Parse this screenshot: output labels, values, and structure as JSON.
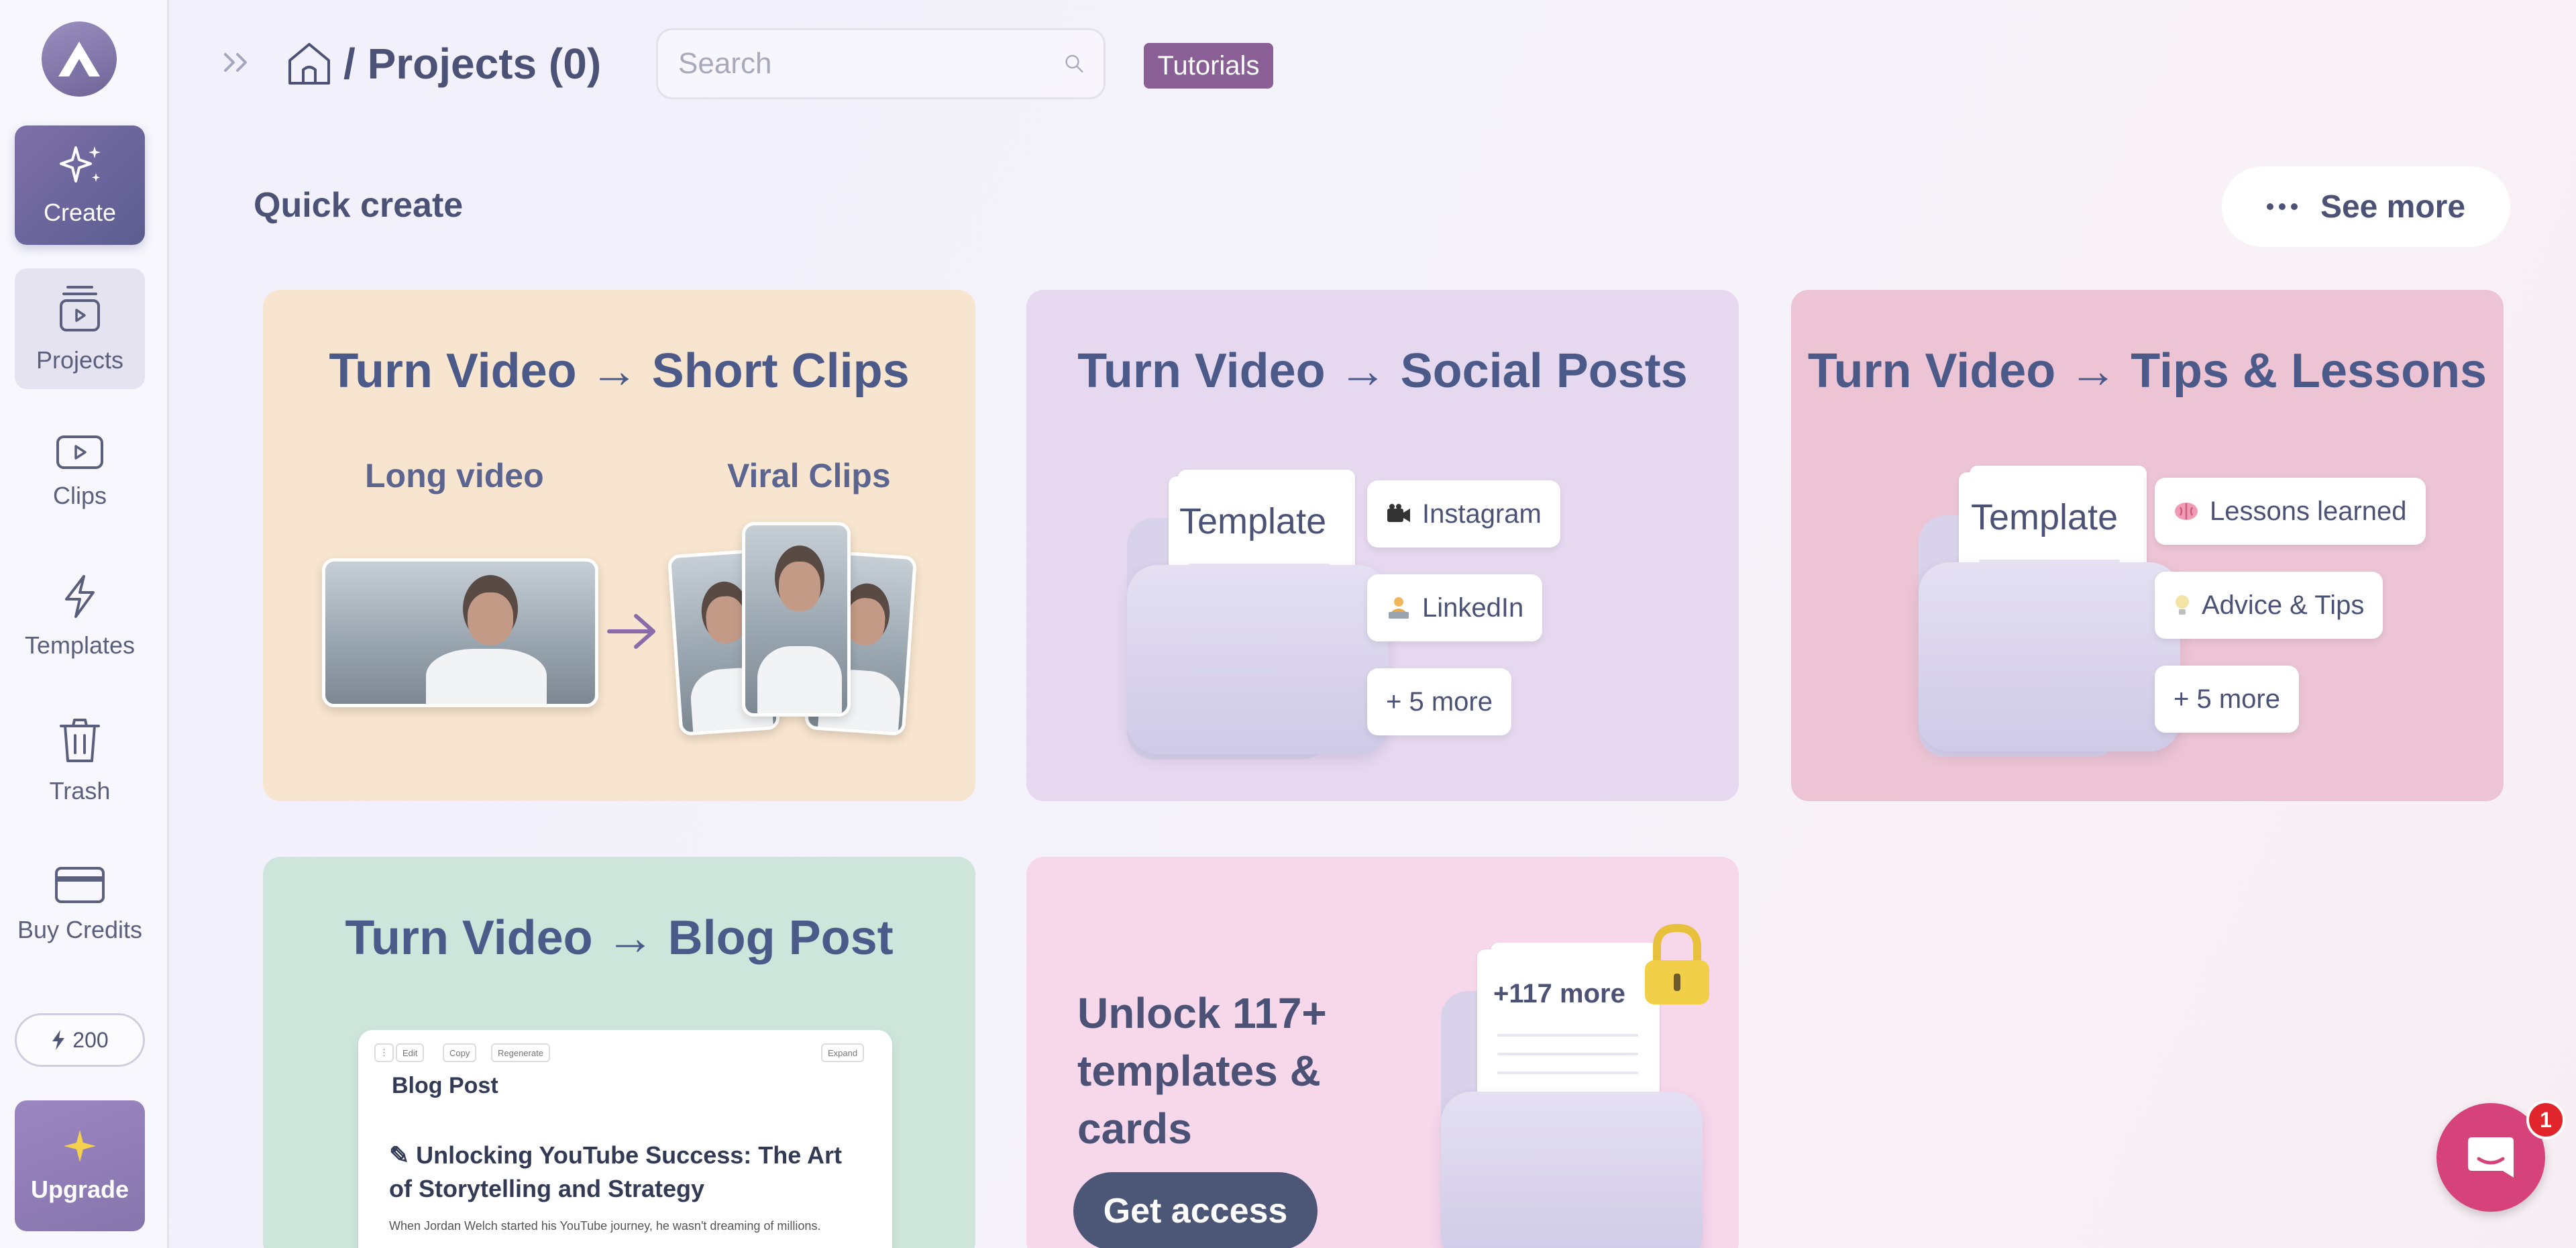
{
  "sidebar": {
    "create_label": "Create",
    "projects_label": "Projects",
    "clips_label": "Clips",
    "templates_label": "Templates",
    "trash_label": "Trash",
    "credits_label": "Buy Credits",
    "credits_count": "200",
    "upgrade_label": "Upgrade"
  },
  "header": {
    "breadcrumb_sep": "/",
    "title": "Projects (0)",
    "search_placeholder": "Search",
    "tutorials_label": "Tutorials"
  },
  "quick_create": {
    "title": "Quick create",
    "see_more_label": "See more",
    "cards": {
      "short_clips": {
        "title": "Turn Video → Short Clips",
        "left_label": "Long video",
        "right_label": "Viral Clips"
      },
      "social_posts": {
        "title": "Turn Video → Social Posts",
        "paper_title": "Template",
        "chips": [
          "Instagram",
          "LinkedIn",
          "+ 5 more"
        ]
      },
      "tips_lessons": {
        "title": "Turn Video → Tips & Lessons",
        "paper_title": "Template",
        "chips": [
          "Lessons learned",
          "Advice & Tips",
          "+ 5 more"
        ]
      },
      "blog_post": {
        "title": "Turn Video → Blog Post",
        "toolbar": [
          "Edit",
          "Copy",
          "Regenerate",
          "Expand"
        ],
        "doc_title": "Blog Post",
        "doc_heading": "Unlocking YouTube Success: The Art of Storytelling and Strategy",
        "doc_body": "When Jordan Welch started his YouTube journey, he wasn't dreaming of millions."
      },
      "unlock": {
        "text": "Unlock 117+ templates & cards",
        "paper_label": "+117 more",
        "button_label": "Get access"
      }
    }
  },
  "chat": {
    "badge_count": "1"
  },
  "colors": {
    "create_bg": "#6a6596",
    "tutorials_bg": "#8a5f96",
    "card_short_clips": "#f8e5cf",
    "card_social_posts": "#e6d8ef",
    "card_tips": "#ecc4d3",
    "card_blog": "#cde5da",
    "card_unlock": "#f7d7ea",
    "chat_bg": "#d6427a"
  }
}
